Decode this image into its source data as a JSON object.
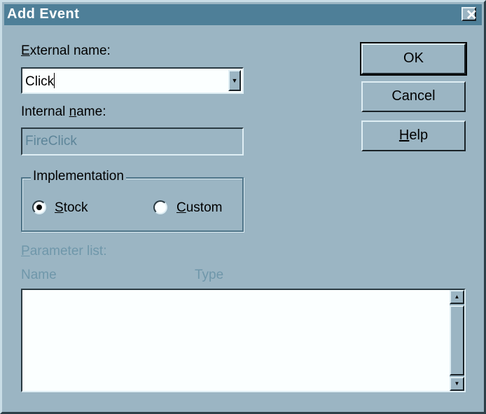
{
  "window": {
    "title": "Add Event",
    "close_icon": "close-icon"
  },
  "external_name": {
    "label_accel": "E",
    "label_rest": "xternal name:",
    "value": "Click"
  },
  "internal_name": {
    "label_pre": "Internal ",
    "label_accel": "n",
    "label_rest": "ame:",
    "value": "FireClick"
  },
  "implementation": {
    "legend": "Implementation",
    "options": [
      {
        "accel": "S",
        "rest": "tock",
        "selected": true
      },
      {
        "accel": "C",
        "rest": "ustom",
        "selected": false
      }
    ]
  },
  "parameters": {
    "label_accel": "P",
    "label_rest": "arameter list:",
    "columns": [
      "Name",
      "Type"
    ]
  },
  "buttons": {
    "ok": "OK",
    "cancel": "Cancel",
    "help_accel": "H",
    "help_rest": "elp"
  },
  "colors": {
    "background": "#9bb5c3",
    "titlebar": "#4e7f98"
  }
}
